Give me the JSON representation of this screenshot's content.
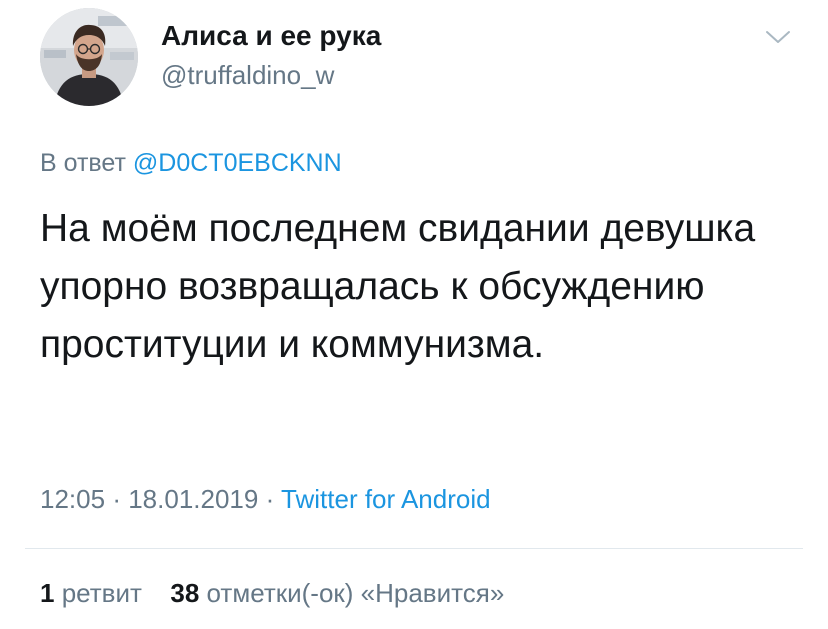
{
  "tweet": {
    "author_name": "Алиса и ее рука",
    "author_handle": "@truffaldino_w",
    "reply_prefix": "В ответ",
    "reply_mention": "@D0CT0EBCKNN",
    "text": "На моём последнем свидании девушка упорно возвращалась к обсуждению проституции и коммунизма.",
    "time": "12:05",
    "date": "18.01.2019",
    "separator": "·",
    "source": "Twitter for Android",
    "retweets_count": "1",
    "retweets_label": "ретвит",
    "likes_count": "38",
    "likes_label": "отметки(-ок) «Нравится»"
  },
  "icons": {
    "menu": "chevron-down-icon",
    "avatar": "avatar"
  },
  "colors": {
    "link": "#1b95e0",
    "secondary": "#657786",
    "primary": "#14171a",
    "divider": "#e1e8ed"
  }
}
